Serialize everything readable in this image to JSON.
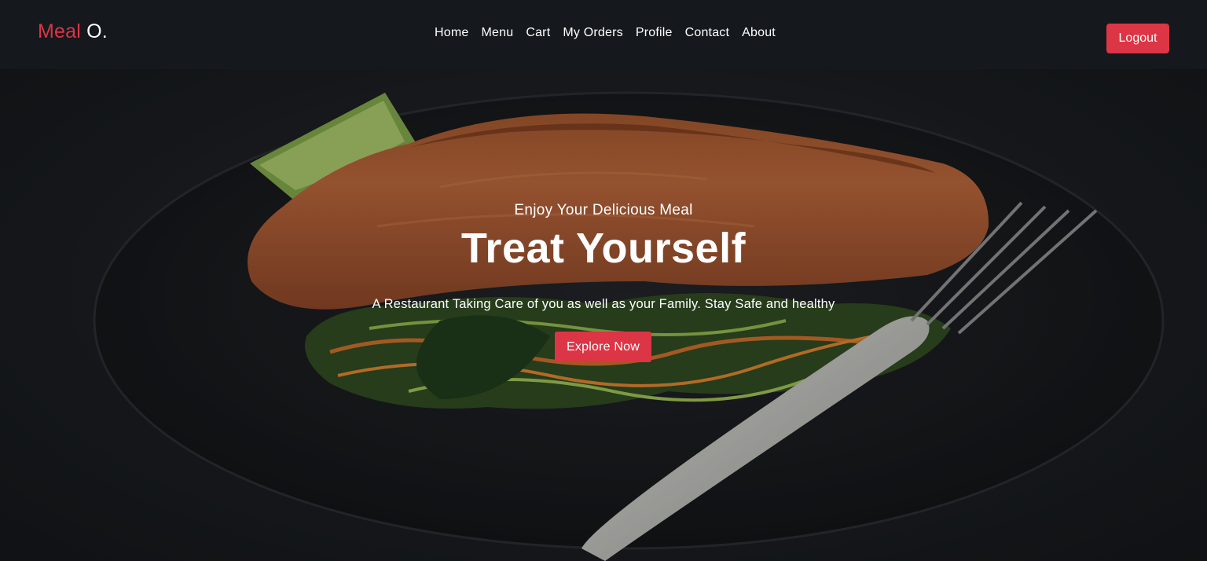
{
  "brand": {
    "accent": "Meal",
    "rest": " O."
  },
  "nav": {
    "items": [
      {
        "label": "Home"
      },
      {
        "label": "Menu"
      },
      {
        "label": "Cart"
      },
      {
        "label": "My Orders"
      },
      {
        "label": "Profile"
      },
      {
        "label": "Contact"
      },
      {
        "label": "About"
      }
    ],
    "logout_label": "Logout"
  },
  "hero": {
    "subtitle": "Enjoy Your Delicious Meal",
    "title": "Treat Yourself",
    "description": "A Restaurant Taking Care of you as well as your Family. Stay Safe and healthy",
    "cta_label": "Explore Now",
    "background_image": "salmon-plate-photo"
  },
  "colors": {
    "accent": "#dc3545",
    "navbar_bg": "#15181c",
    "text": "#ffffff"
  }
}
